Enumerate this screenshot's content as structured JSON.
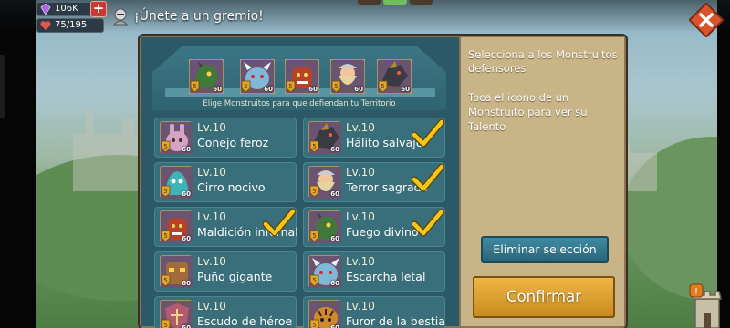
{
  "resources": {
    "gems": "106K",
    "stamina": "75/195"
  },
  "header": {
    "title": "¡Únete a un gremio!"
  },
  "defenders": {
    "slots": [
      {
        "icon": "green-dragon-monster",
        "level": "60",
        "color": "#3f7a3a"
      },
      {
        "icon": "ice-beast-monster",
        "level": "60",
        "color": "#7fb8d9"
      },
      {
        "icon": "red-ogre-monster",
        "level": "60",
        "color": "#b8412c"
      },
      {
        "icon": "bearded-hermit-monster",
        "level": "60",
        "color": "#e4d4a2"
      },
      {
        "icon": "dark-dragon-monster",
        "level": "60",
        "color": "#3a3a44"
      }
    ],
    "hint": "Elige Monstruitos para que defiendan tu Territorio"
  },
  "monsters": [
    {
      "level": "Lv.10",
      "name": "Conejo feroz",
      "badge": "60",
      "selected": false,
      "icon": "pink-rabbit-monster",
      "color": "#d7a3c4"
    },
    {
      "level": "Lv.10",
      "name": "Hálito salvaje",
      "badge": "60",
      "selected": true,
      "icon": "dark-dragon-monster",
      "color": "#3a3a44"
    },
    {
      "level": "Lv.10",
      "name": "Cirro nocivo",
      "badge": "60",
      "selected": false,
      "icon": "teal-spirit-monster",
      "color": "#3fb3b5"
    },
    {
      "level": "Lv.10",
      "name": "Terror sagrado",
      "badge": "60",
      "selected": true,
      "icon": "bearded-hermit-monster",
      "color": "#e4d4a2"
    },
    {
      "level": "Lv.10",
      "name": "Maldición infernal",
      "badge": "60",
      "selected": true,
      "icon": "red-ogre-monster",
      "color": "#b8412c"
    },
    {
      "level": "Lv.10",
      "name": "Fuego divino",
      "badge": "60",
      "selected": true,
      "icon": "green-dragon-monster",
      "color": "#3f7a3a"
    },
    {
      "level": "Lv.10",
      "name": "Puño gigante",
      "badge": "60",
      "selected": false,
      "icon": "rock-golem-monster",
      "color": "#a26b3a"
    },
    {
      "level": "Lv.10",
      "name": "Escarcha letal",
      "badge": "60",
      "selected": false,
      "icon": "ice-beast-monster",
      "color": "#7fb8d9"
    },
    {
      "level": "Lv.10",
      "name": "Escudo de héroe",
      "badge": "60",
      "selected": false,
      "icon": "shield-knight-monster",
      "color": "#b45a6e"
    },
    {
      "level": "Lv.10",
      "name": "Furor de la bestia",
      "badge": "60",
      "selected": false,
      "icon": "tiger-beast-monster",
      "color": "#d08a2c"
    }
  ],
  "info": {
    "line1": "Selecciona a los Monstruitos defensores",
    "line2": "Toca el icono de un Monstruito para ver su Talento"
  },
  "buttons": {
    "clear": "Eliminar selección",
    "confirm": "Confirmar"
  },
  "colors": {
    "panel": "#2d5763",
    "card": "#396e7b",
    "info_panel": "#c8b487",
    "confirm": "#e5a332",
    "clear": "#337a91",
    "check": "#f5c518"
  }
}
